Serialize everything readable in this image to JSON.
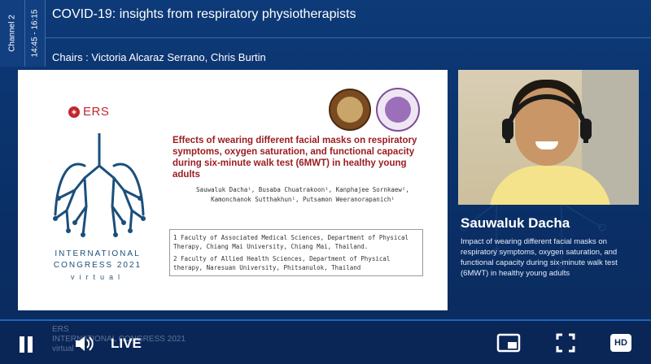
{
  "header": {
    "channel": "Channel 2",
    "time": "14:45 - 16:15",
    "title": "COVID-19: insights from respiratory physiotherapists",
    "chairs": "Chairs : Victoria Alcaraz Serrano, Chris Burtin"
  },
  "slide": {
    "ers_label": "ERS",
    "congress_line1": "INTERNATIONAL",
    "congress_line2": "CONGRESS 2021",
    "congress_line3": "virtual",
    "title": "Effects of wearing different facial masks on respiratory symptoms, oxygen saturation, and functional capacity during six-minute walk test (6MWT) in healthy young adults",
    "authors_line1": "Sauwaluk Dacha¹, Busaba Chuatrakoon¹, Kanphajee Sornkaew²,",
    "authors_line2": "Kamonchanok Sutthakhun¹, Putsamon Weeranorapanich¹",
    "affiliation1": "1 Faculty of Associated Medical Sciences, Department of Physical Therapy, Chiang Mai University, Chiang Mai, Thailand.",
    "affiliation2": "2 Faculty of Allied Health Sciences, Department of Physical therapy, Naresuan University, Phitsanulok, Thailand"
  },
  "speaker": {
    "name": "Sauwaluk Dacha",
    "description": "Impact of wearing different facial masks on respiratory symptoms, oxygen saturation, and functional capacity during six-minute walk test (6MWT) in healthy young adults"
  },
  "player": {
    "faint_ers": "ERS",
    "faint_congress": "INTERNATIONAL CONGRESS 2021",
    "faint_virtual": "virtual",
    "live_label": "LIVE",
    "hd_label": "HD",
    "icons": {
      "pause": "pause-icon",
      "volume": "volume-icon",
      "pip": "picture-in-picture-icon",
      "fullscreen": "fullscreen-icon"
    }
  },
  "colors": {
    "background": "#0b2f63",
    "accent": "#1e66c0",
    "title_red": "#9a1b1f",
    "ers_red": "#c0272d"
  }
}
